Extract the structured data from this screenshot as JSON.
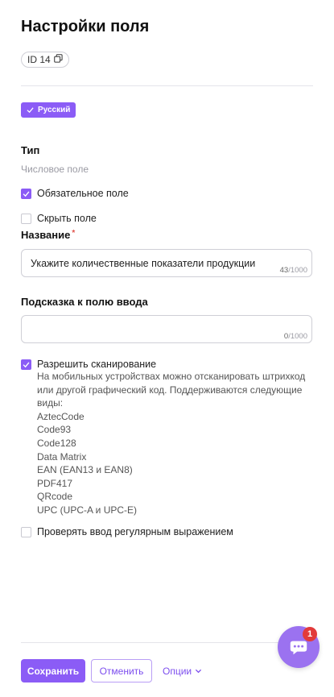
{
  "header": {
    "title": "Настройки поля"
  },
  "id_chip": {
    "label": "ID 14",
    "icon": "copy-icon"
  },
  "language": {
    "label": "Русский",
    "icon": "check-icon",
    "color": "#8b5cf6"
  },
  "type": {
    "label": "Тип",
    "value": "Числовое поле"
  },
  "options": {
    "required": {
      "label": "Обязательное поле",
      "checked": true
    },
    "hidden": {
      "label": "Скрыть поле",
      "checked": false
    }
  },
  "name_field": {
    "label": "Название",
    "required_mark": "*",
    "value": "Укажите количественные показатели продукции",
    "counter_current": "43",
    "counter_max": "/1000"
  },
  "hint_field": {
    "label": "Подсказка к полю ввода",
    "value": "",
    "counter_current": "0",
    "counter_max": "/1000"
  },
  "scanning": {
    "label": "Разрешить сканирование",
    "checked": true,
    "description": "На мобильных устройствах можно отсканировать штрихкод или другой графический код. Поддерживаются следующие виды:",
    "formats": [
      "AztecCode",
      "Code93",
      "Code128",
      "Data Matrix",
      "EAN (EAN13 и EAN8)",
      "PDF417",
      "QRcode",
      "UPC (UPC-A и UPC-E)"
    ]
  },
  "regex": {
    "label": "Проверять ввод регулярным выражением",
    "checked": false
  },
  "footer": {
    "save_label": "Сохранить",
    "cancel_label": "Отменить",
    "options_label": "Опции"
  },
  "chat": {
    "badge_count": "1",
    "icon": "chat-icon",
    "color": "#9b72f0"
  }
}
